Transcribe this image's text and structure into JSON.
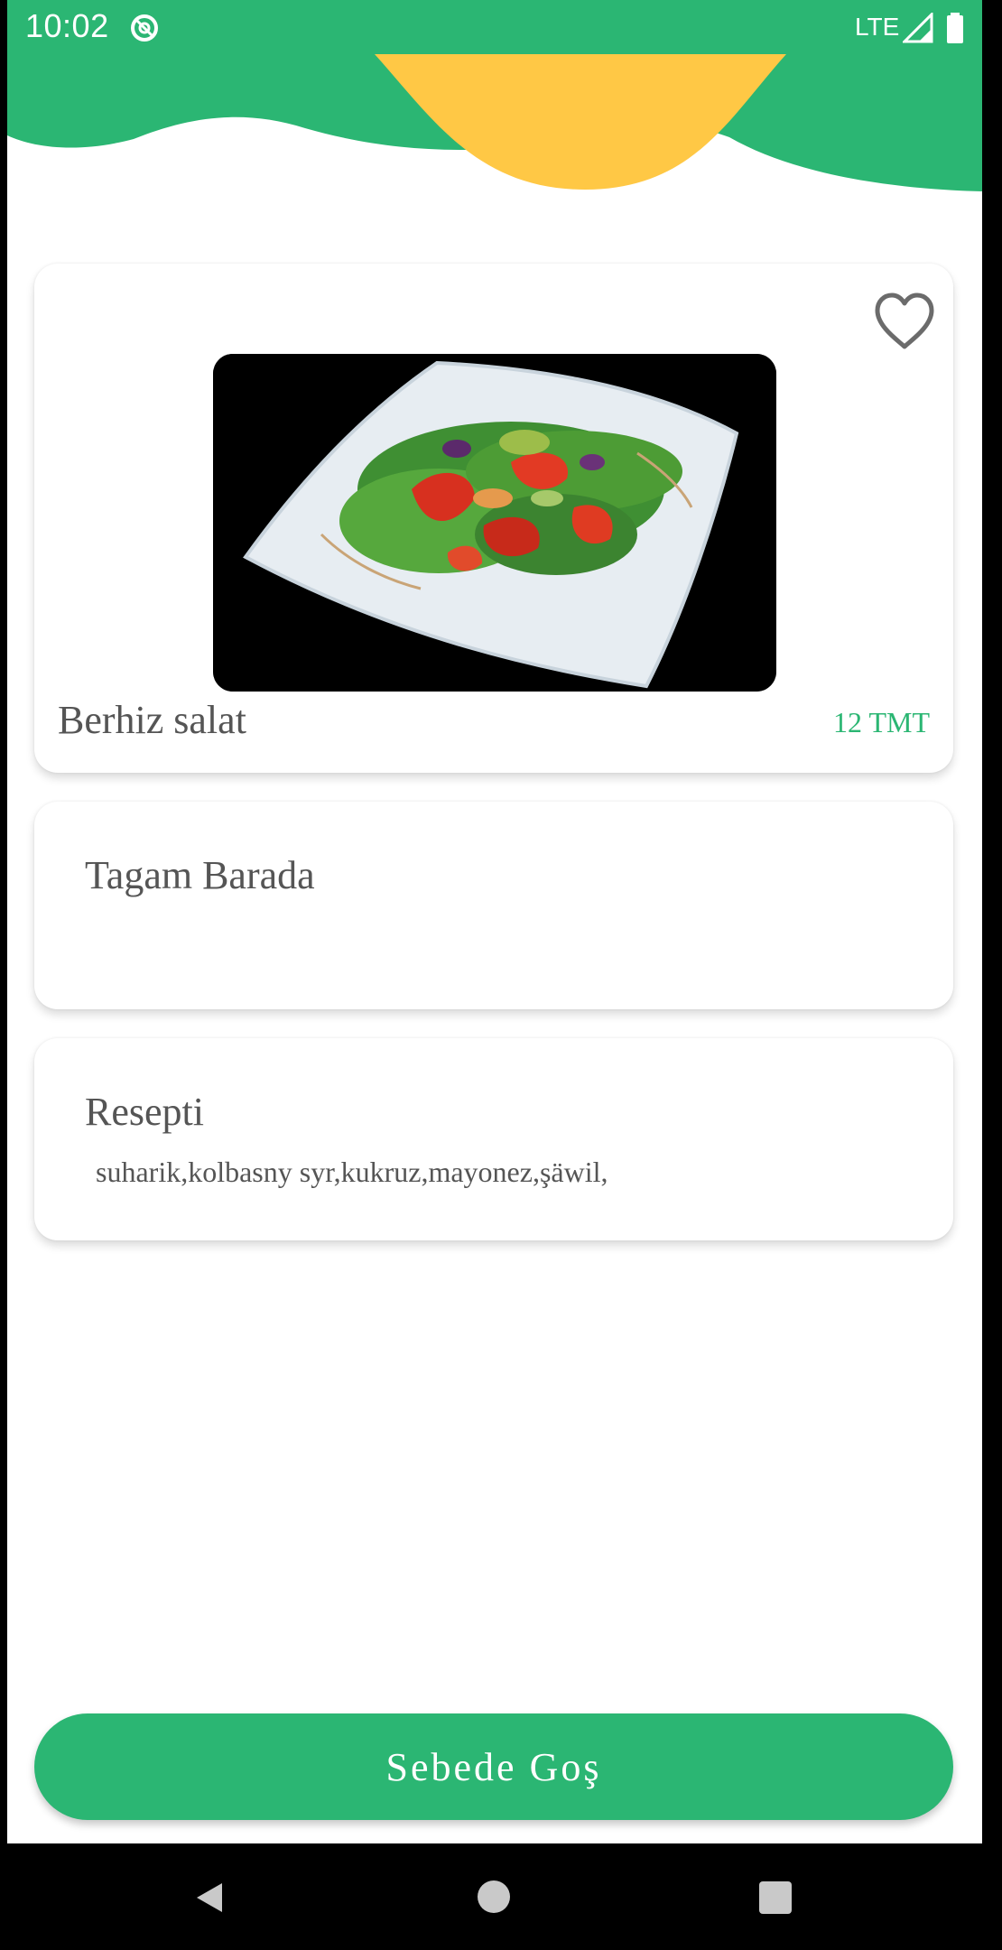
{
  "status_bar": {
    "time": "10:02",
    "network": "LTE"
  },
  "colors": {
    "accent": "#2bb673",
    "header_shape": "#ffc845",
    "text": "#555555"
  },
  "food": {
    "name": "Berhiz salat",
    "price": "12 TMT",
    "image_icon": "salad-photo",
    "favorite_icon": "heart-outline-icon"
  },
  "about": {
    "title": "Tagam Barada"
  },
  "recipe": {
    "title": "Resepti",
    "ingredients": "suharik,kolbasny syr,kukruz,mayonez,şäwil,"
  },
  "actions": {
    "add_to_cart_label": "Sebede Goş"
  },
  "navigation": {
    "back_icon": "back-icon",
    "home_icon": "home-icon",
    "recents_icon": "recents-icon"
  }
}
